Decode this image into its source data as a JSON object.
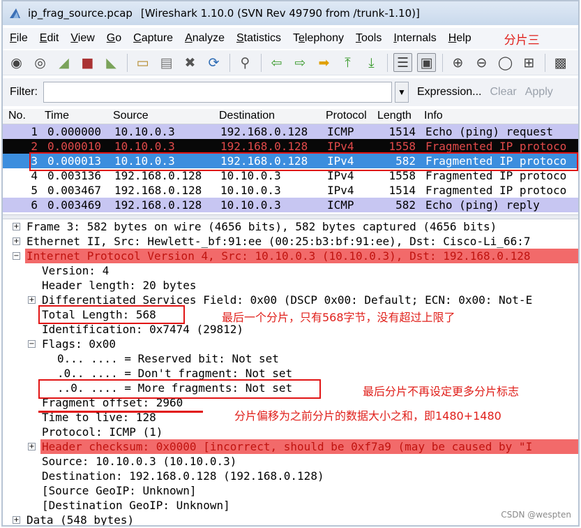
{
  "window": {
    "filename": "ip_frag_source.pcap",
    "app_title": "[Wireshark 1.10.0  (SVN Rev 49790 from /trunk-1.10)]"
  },
  "menu": [
    "File",
    "Edit",
    "View",
    "Go",
    "Capture",
    "Analyze",
    "Statistics",
    "Telephony",
    "Tools",
    "Internals",
    "Help"
  ],
  "menu_mnemonic_index": [
    0,
    0,
    0,
    0,
    0,
    0,
    0,
    1,
    0,
    0,
    0
  ],
  "annotation_title": "分片三",
  "toolbar_icons": [
    "interface-list-icon",
    "capture-options-icon",
    "start-capture-icon",
    "stop-capture-icon",
    "restart-capture-icon",
    "open-file-icon",
    "save-file-icon",
    "close-file-icon",
    "reload-icon",
    "find-packet-icon",
    "go-back-icon",
    "go-forward-icon",
    "go-to-packet-icon",
    "go-first-icon",
    "go-last-icon",
    "colorize-icon",
    "auto-scroll-icon",
    "zoom-in-icon",
    "zoom-out-icon",
    "normal-size-icon",
    "resize-columns-icon",
    "capture-filters-icon"
  ],
  "filter": {
    "label": "Filter:",
    "value": "",
    "expression": "Expression...",
    "clear": "Clear",
    "apply": "Apply"
  },
  "packet_columns": [
    "No.",
    "Time",
    "Source",
    "Destination",
    "Protocol",
    "Length",
    "Info"
  ],
  "packets": [
    {
      "no": "1",
      "time": "0.000000",
      "source": "10.10.0.3",
      "destination": "192.168.0.128",
      "protocol": "ICMP",
      "length": "1514",
      "info": "Echo (ping) request",
      "style": "echo"
    },
    {
      "no": "2",
      "time": "0.000010",
      "source": "10.10.0.3",
      "destination": "192.168.0.128",
      "protocol": "IPv4",
      "length": "1558",
      "info": "Fragmented IP protoco",
      "style": "black"
    },
    {
      "no": "3",
      "time": "0.000013",
      "source": "10.10.0.3",
      "destination": "192.168.0.128",
      "protocol": "IPv4",
      "length": "582",
      "info": "Fragmented IP protoco",
      "style": "selected"
    },
    {
      "no": "4",
      "time": "0.003136",
      "source": "192.168.0.128",
      "destination": "10.10.0.3",
      "protocol": "IPv4",
      "length": "1558",
      "info": "Fragmented IP protoco",
      "style": "white"
    },
    {
      "no": "5",
      "time": "0.003467",
      "source": "192.168.0.128",
      "destination": "10.10.0.3",
      "protocol": "IPv4",
      "length": "1514",
      "info": "Fragmented IP protoco",
      "style": "white"
    },
    {
      "no": "6",
      "time": "0.003469",
      "source": "192.168.0.128",
      "destination": "10.10.0.3",
      "protocol": "ICMP",
      "length": "582",
      "info": "Echo (ping) reply",
      "style": "echo"
    }
  ],
  "details": [
    {
      "text": "Frame 3: 582 bytes on wire (4656 bits), 582 bytes captured (4656 bits)",
      "expander": "+",
      "indent": 0,
      "highlight": false
    },
    {
      "text": "Ethernet II, Src: Hewlett-_bf:91:ee (00:25:b3:bf:91:ee), Dst: Cisco-Li_66:7",
      "expander": "+",
      "indent": 0,
      "highlight": false
    },
    {
      "text": "Internet Protocol Version 4, Src: 10.10.0.3 (10.10.0.3), Dst: 192.168.0.128",
      "expander": "−",
      "indent": 0,
      "highlight": true
    },
    {
      "text": "Version: 4",
      "expander": "",
      "indent": 1,
      "highlight": false
    },
    {
      "text": "Header length: 20 bytes",
      "expander": "",
      "indent": 1,
      "highlight": false
    },
    {
      "text": "Differentiated Services Field: 0x00 (DSCP 0x00: Default; ECN: 0x00: Not-E",
      "expander": "+",
      "indent": 1,
      "highlight": false
    },
    {
      "text": "Total Length: 568",
      "expander": "",
      "indent": 1,
      "highlight": false
    },
    {
      "text": "Identification: 0x7474 (29812)",
      "expander": "",
      "indent": 1,
      "highlight": false
    },
    {
      "text": "Flags: 0x00",
      "expander": "−",
      "indent": 1,
      "highlight": false
    },
    {
      "text": "0... .... = Reserved bit: Not set",
      "expander": "",
      "indent": 2,
      "highlight": false
    },
    {
      "text": ".0.. .... = Don't fragment: Not set",
      "expander": "",
      "indent": 2,
      "highlight": false
    },
    {
      "text": "..0. .... = More fragments: Not set",
      "expander": "",
      "indent": 2,
      "highlight": false
    },
    {
      "text": "Fragment offset: 2960",
      "expander": "",
      "indent": 1,
      "highlight": false
    },
    {
      "text": "Time to live: 128",
      "expander": "",
      "indent": 1,
      "highlight": false
    },
    {
      "text": "Protocol: ICMP (1)",
      "expander": "",
      "indent": 1,
      "highlight": false
    },
    {
      "text": "Header checksum: 0x0000 [incorrect, should be 0xf7a9 (may be caused by \"I",
      "expander": "+",
      "indent": 1,
      "highlight": true
    },
    {
      "text": "Source: 10.10.0.3 (10.10.0.3)",
      "expander": "",
      "indent": 1,
      "highlight": false
    },
    {
      "text": "Destination: 192.168.0.128 (192.168.0.128)",
      "expander": "",
      "indent": 1,
      "highlight": false
    },
    {
      "text": "[Source GeoIP: Unknown]",
      "expander": "",
      "indent": 1,
      "highlight": false
    },
    {
      "text": "[Destination GeoIP: Unknown]",
      "expander": "",
      "indent": 1,
      "highlight": false
    },
    {
      "text": "Data (548 bytes)",
      "expander": "+",
      "indent": 0,
      "highlight": false
    }
  ],
  "annotations": {
    "total_length": "最后一个分片，只有568字节，没有超过上限了",
    "more_fragments": "最后分片不再设定更多分片标志",
    "fragment_offset": "分片偏移为之前分片的数据大小之和，即1480+1480"
  },
  "watermark": "CSDN @wespten",
  "colors": {
    "accent_red": "#e11515",
    "selected_row": "#3c8ede",
    "icmp_row": "#c7c6f2",
    "bad_row": "#080808",
    "error_highlight": "#f26a6a"
  }
}
